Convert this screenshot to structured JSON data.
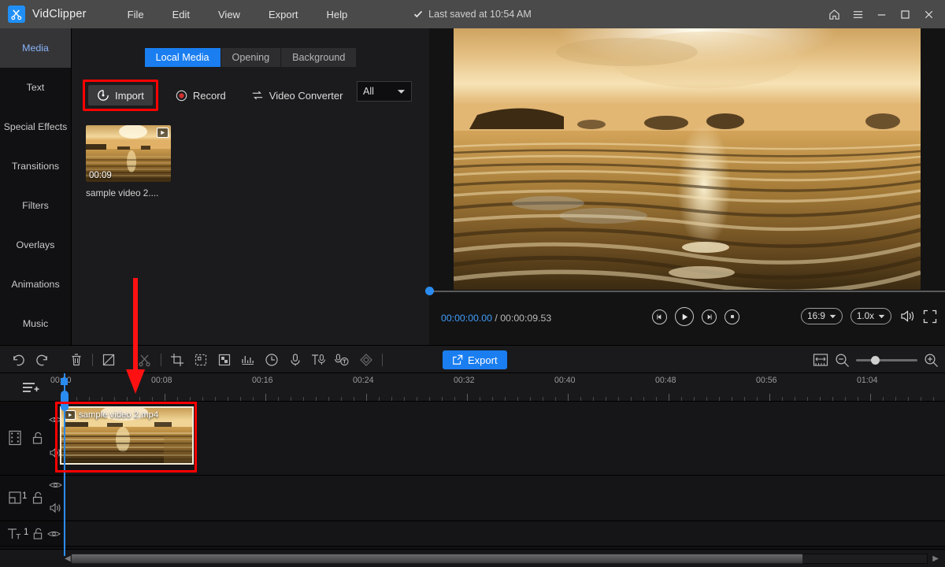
{
  "titlebar": {
    "app_name": "VidClipper",
    "logo_icon": "scissors-film-logo",
    "menu": [
      "File",
      "Edit",
      "View",
      "Export",
      "Help"
    ],
    "saved_status": "Last saved at 10:54 AM",
    "saved_check_icon": "check-icon",
    "window_buttons": [
      "home-icon",
      "hamburger-menu-icon",
      "minimize-icon",
      "maximize-icon",
      "close-icon"
    ]
  },
  "sidebar": {
    "items": [
      {
        "label": "Media",
        "active": true
      },
      {
        "label": "Text",
        "active": false
      },
      {
        "label": "Special Effects",
        "active": false
      },
      {
        "label": "Transitions",
        "active": false
      },
      {
        "label": "Filters",
        "active": false
      },
      {
        "label": "Overlays",
        "active": false
      },
      {
        "label": "Animations",
        "active": false
      },
      {
        "label": "Music",
        "active": false
      }
    ]
  },
  "media_panel": {
    "tabs": [
      {
        "label": "Local Media",
        "active": true
      },
      {
        "label": "Opening",
        "active": false
      },
      {
        "label": "Background",
        "active": false
      }
    ],
    "import_label": "Import",
    "import_icon": "import-disc-icon",
    "record_label": "Record",
    "record_icon": "record-circle-icon",
    "converter_label": "Video Converter",
    "converter_icon": "convert-arrows-icon",
    "filter_value": "All",
    "filter_caret_icon": "chevron-down-icon",
    "items": [
      {
        "name": "sample video 2....",
        "duration": "00:09",
        "badge_icon": "video-play-badge-icon"
      }
    ]
  },
  "preview": {
    "current_time": "00:00:00.00",
    "time_separator": " / ",
    "total_time": "00:00:09.53",
    "transport": [
      {
        "name": "prev-frame-button",
        "icon": "prev-frame-icon"
      },
      {
        "name": "play-button",
        "icon": "play-icon"
      },
      {
        "name": "next-frame-button",
        "icon": "next-frame-icon"
      },
      {
        "name": "stop-button",
        "icon": "stop-icon"
      }
    ],
    "aspect_ratio": "16:9",
    "playback_speed": "1.0x",
    "volume_icon": "volume-icon",
    "fullscreen_icon": "fullscreen-icon"
  },
  "toolbar": {
    "left_icons": [
      "undo-icon",
      "redo-icon",
      "delete-icon",
      "split-edit-icon",
      "cut-scissors-icon",
      "crop-icon",
      "resize-icon",
      "mosaic-icon",
      "audio-levels-icon",
      "duration-clock-icon",
      "microphone-icon",
      "text-to-speech-icon",
      "speech-to-text-icon",
      "keyframe-icon"
    ],
    "export_label": "Export",
    "export_icon": "export-share-icon",
    "fit-timeline_icon": "fit-to-timeline-icon",
    "zoom_out_icon": "zoom-out-icon",
    "zoom_in_icon": "zoom-in-icon",
    "zoom_value": 28
  },
  "timeline": {
    "menu_icon": "timeline-menu-icon",
    "ruler_labels": [
      "00:00",
      "00:08",
      "00:16",
      "00:24",
      "00:32",
      "00:40",
      "00:48",
      "00:56",
      "01:04"
    ],
    "tracks": [
      {
        "type": "video",
        "icon": "film-strip-icon",
        "lock_icon": "unlock-icon",
        "eye_icon": "eye-icon",
        "mute_icon": "speaker-icon",
        "number": ""
      },
      {
        "type": "overlay",
        "icon": "pip-overlay-icon",
        "lock_icon": "unlock-icon",
        "eye_icon": "eye-icon",
        "mute_icon": "speaker-icon",
        "number": "1"
      },
      {
        "type": "text",
        "icon": "text-track-icon",
        "lock_icon": "unlock-icon",
        "eye_icon": "eye-icon",
        "mute_icon": "",
        "number": "1"
      }
    ],
    "clip": {
      "name": "sample video 2.mp4",
      "badge_icon": "video-play-badge-icon"
    },
    "scroll_left_icon": "scroll-left-icon",
    "scroll_right_icon": "scroll-right-icon"
  },
  "annotations": {
    "highlight_color": "#ff0000",
    "arrow_color": "#ff1111",
    "import_highlight": true,
    "clip_highlight": true,
    "arrow_from_import_to_timeline": true
  },
  "colors": {
    "accent_blue": "#1a7ef0",
    "titlebar_bg": "#4a4a4a",
    "panel_bg": "#1b1b1d",
    "timeline_bg": "#121214",
    "playhead": "#2b8cf0",
    "active_tab_text": "#8ab4f8"
  }
}
